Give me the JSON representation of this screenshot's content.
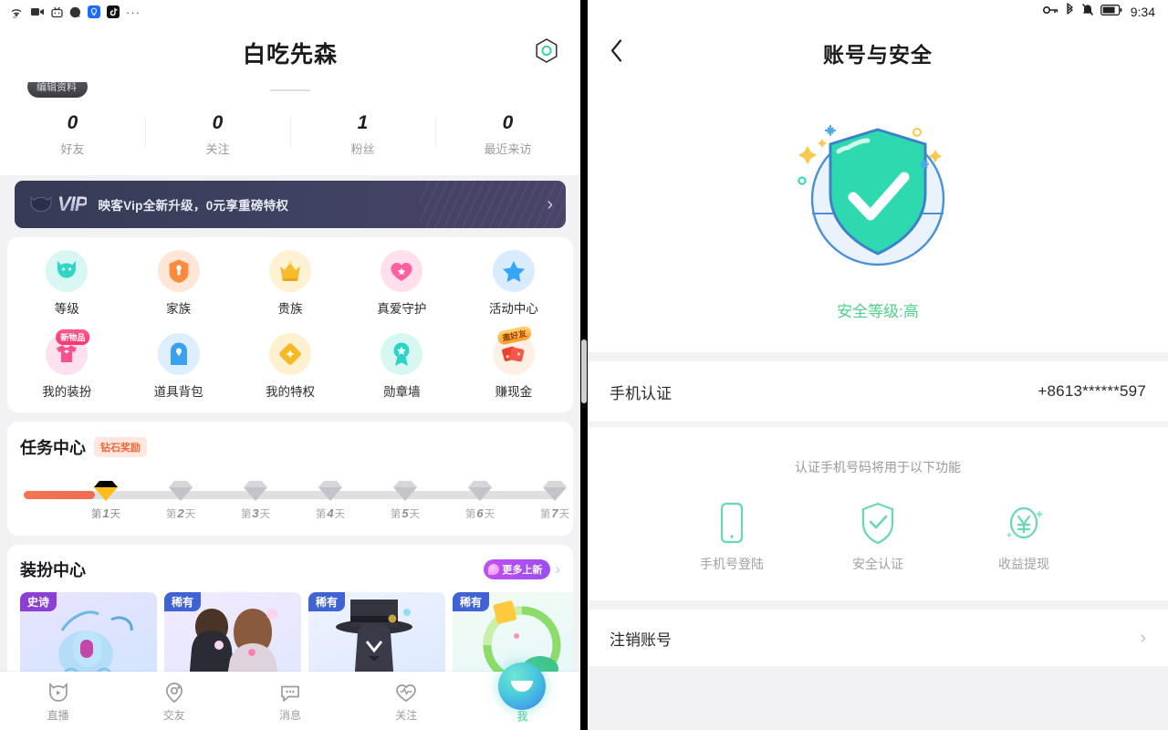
{
  "left": {
    "status_bar": {
      "icons": [
        "wifi-icon",
        "video-camera-icon",
        "tv-icon",
        "qq-icon",
        "browser-icon",
        "tiktok-icon"
      ],
      "overflow": "···"
    },
    "header": {
      "title": "白吃先森",
      "right_icon": "hexagon-badge-icon"
    },
    "edit_profile_label": "编辑资料",
    "stats": [
      {
        "value": "0",
        "label": "好友"
      },
      {
        "value": "0",
        "label": "关注"
      },
      {
        "value": "1",
        "label": "粉丝"
      },
      {
        "value": "0",
        "label": "最近来访"
      }
    ],
    "vip_banner": {
      "logo": "VIP",
      "text": "映客Vip全新升级，0元享重磅特权",
      "chevron": "›",
      "bg_color": "#3d4160"
    },
    "grid": {
      "row1": [
        {
          "label": "等级",
          "icon": "level-cat-icon",
          "bg": "#d9f7f2",
          "fg": "#2fd6c5"
        },
        {
          "label": "家族",
          "icon": "family-icon",
          "bg": "#ffe6d6",
          "fg": "#ff8a3d"
        },
        {
          "label": "贵族",
          "icon": "crown-icon",
          "bg": "#fff1d3",
          "fg": "#f7bb2e"
        },
        {
          "label": "真爱守护",
          "icon": "heart-guard-icon",
          "bg": "#ffdfec",
          "fg": "#ff5f9e"
        },
        {
          "label": "活动中心",
          "icon": "star-icon",
          "bg": "#d9ecff",
          "fg": "#35a6f5"
        }
      ],
      "row2": [
        {
          "label": "我的装扮",
          "icon": "tshirt-icon",
          "bg": "#ffe0ee",
          "fg": "#ff4f91",
          "badge": "新物品"
        },
        {
          "label": "道具背包",
          "icon": "backpack-icon",
          "bg": "#dceeff",
          "fg": "#3aa0f0"
        },
        {
          "label": "我的特权",
          "icon": "diamond-icon",
          "bg": "#fff0cf",
          "fg": "#f6b825"
        },
        {
          "label": "勋章墙",
          "icon": "medal-icon",
          "bg": "#d6f7f2",
          "fg": "#2ed3c6"
        },
        {
          "label": "赚现金",
          "icon": "red-packet-icon",
          "bg": "#fff0e6",
          "fg": "#e8422f",
          "corner_badge": "邀好友"
        }
      ]
    },
    "task_center": {
      "title": "任务中心",
      "tag": "钻石奖励",
      "progress_percent": 12,
      "days": [
        {
          "label_prefix": "第",
          "num": "1",
          "label_suffix": "天",
          "state": "active"
        },
        {
          "label_prefix": "第",
          "num": "2",
          "label_suffix": "天",
          "state": "locked"
        },
        {
          "label_prefix": "第",
          "num": "3",
          "label_suffix": "天",
          "state": "locked"
        },
        {
          "label_prefix": "第",
          "num": "4",
          "label_suffix": "天",
          "state": "locked"
        },
        {
          "label_prefix": "第",
          "num": "5",
          "label_suffix": "天",
          "state": "locked"
        },
        {
          "label_prefix": "第",
          "num": "6",
          "label_suffix": "天",
          "state": "locked"
        },
        {
          "label_prefix": "第",
          "num": "7",
          "label_suffix": "天",
          "state": "locked"
        }
      ]
    },
    "dress_center": {
      "title": "装扮中心",
      "more_label": "更多上新",
      "chevron": "›",
      "items": [
        {
          "rank": "史诗",
          "rank_type": "epic",
          "art": "carriage-art"
        },
        {
          "rank": "稀有",
          "rank_type": "rare",
          "art": "wedding-couple-art"
        },
        {
          "rank": "稀有",
          "rank_type": "rare",
          "art": "gentleman-hat-art"
        },
        {
          "rank": "稀有",
          "rank_type": "rare",
          "art": "green-ring-art"
        }
      ]
    },
    "bottom_tabs": [
      {
        "label": "直播",
        "icon": "live-cat-play-icon",
        "active": false
      },
      {
        "label": "交友",
        "icon": "friends-location-icon",
        "active": false
      },
      {
        "label": "消息",
        "icon": "message-bubble-icon",
        "active": false
      },
      {
        "label": "关注",
        "icon": "heart-pulse-icon",
        "active": false
      },
      {
        "label": "我",
        "icon": "me-avatar-icon",
        "active": true
      }
    ]
  },
  "right": {
    "status_bar": {
      "icons": [
        "vpn-key-icon",
        "bluetooth-icon",
        "mute-bell-icon",
        "battery-icon"
      ],
      "time": "9:34"
    },
    "header": {
      "title": "账号与安全",
      "back_icon": "chevron-left-icon"
    },
    "hero": {
      "art": "security-shield-check-art",
      "level_text": "安全等级:高",
      "level_color": "#4fd08a"
    },
    "phone_auth": {
      "label": "手机认证",
      "value": "+8613******597"
    },
    "functions": {
      "hint": "认证手机号码将用于以下功能",
      "items": [
        {
          "label": "手机号登陆",
          "icon": "phone-outline-icon"
        },
        {
          "label": "安全认证",
          "icon": "shield-check-icon"
        },
        {
          "label": "收益提现",
          "icon": "yuan-coin-icon"
        }
      ]
    },
    "logout": {
      "label": "注销账号",
      "chevron": "›"
    }
  }
}
